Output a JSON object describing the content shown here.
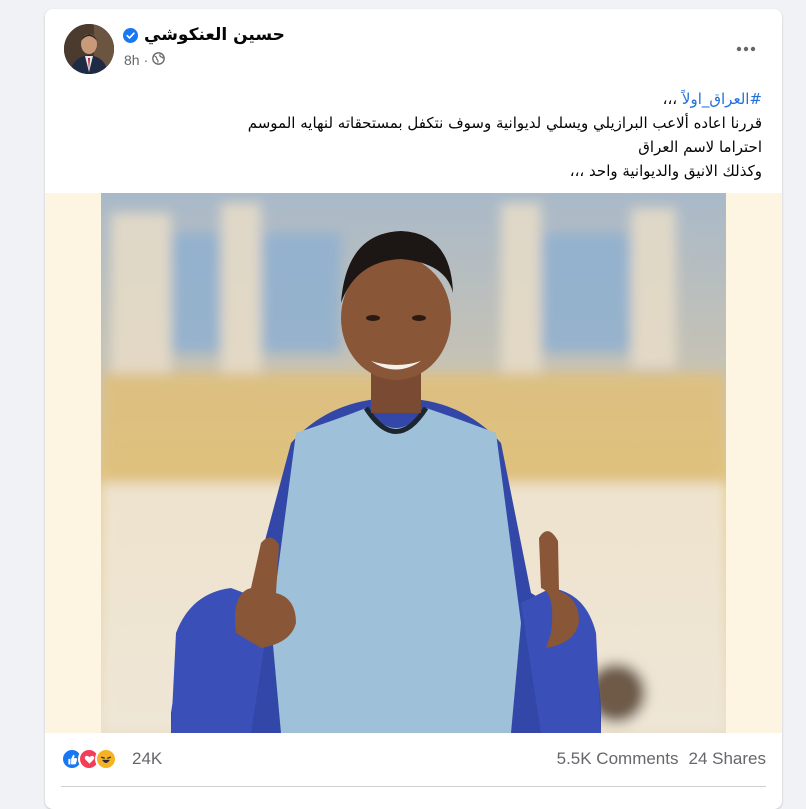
{
  "post": {
    "author": "حسين العنكوشي",
    "timestamp": "8h",
    "audience_icon": "globe-icon",
    "hashtag": "#العراق_اولاً",
    "hashtag_suffix": " ،،،",
    "lines": [
      "قررنا اعاده ألاعب البرازيلي ويسلي لديوانية وسوف نتكفل بمستحقاته لنهايه الموسم",
      "احتراما لاسم العراق",
      "وكذلك الانيق والديوانية واحد ،،،"
    ]
  },
  "footer": {
    "reaction_icons": [
      "like-icon",
      "love-icon",
      "haha-icon"
    ],
    "reaction_count": "24K",
    "comments": "5.5K Comments",
    "shares": "24 Shares"
  },
  "colors": {
    "accent": "#1877f2",
    "hashtag": "#216fdb",
    "love": "#f33e58",
    "haha": "#f7b125",
    "muted_text": "#65676b"
  }
}
